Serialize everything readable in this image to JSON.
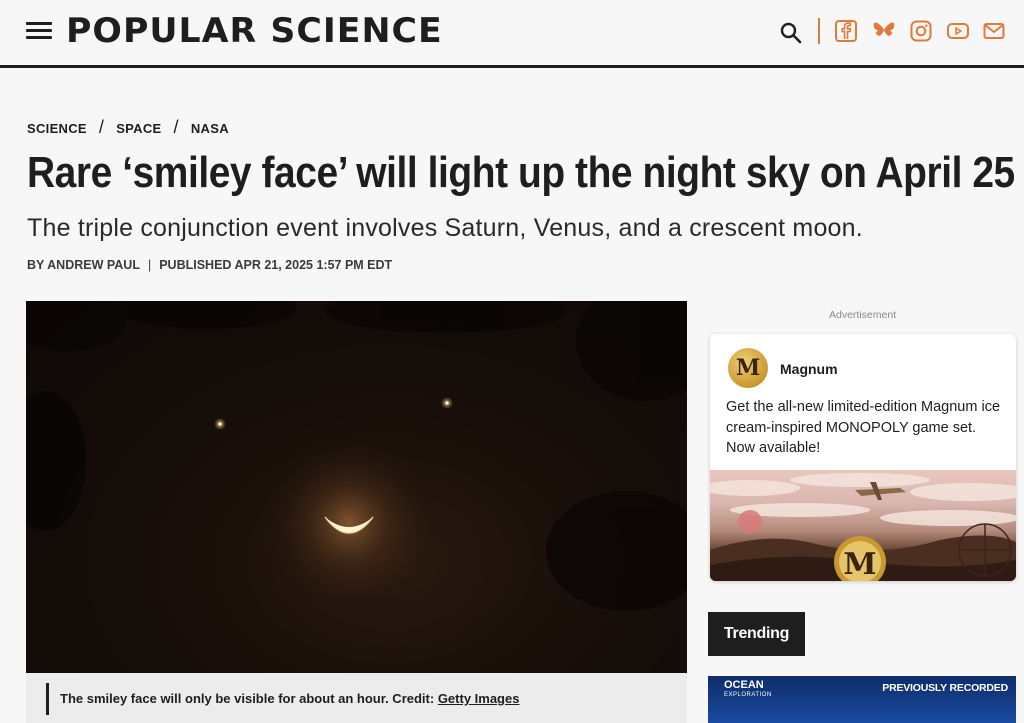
{
  "header": {
    "logo": "POPULAR SCIENCE",
    "accent_color": "#e07a3a",
    "icons": [
      "menu-icon",
      "search-icon",
      "facebook-icon",
      "bluesky-icon",
      "instagram-icon",
      "youtube-icon",
      "email-icon"
    ]
  },
  "breadcrumb": {
    "items": [
      "SCIENCE",
      "SPACE",
      "NASA"
    ],
    "separator": "/"
  },
  "article": {
    "headline": "Rare ‘smiley face’ will light up the night sky on April 25",
    "subhead": "The triple conjunction event involves Saturn, Venus, and a crescent moon.",
    "author": "BY ANDREW PAUL",
    "separator": "|",
    "published": "PUBLISHED APR 21, 2025 1:57 PM EDT",
    "caption": "The smiley face will only be visible for about an hour. Credit: ",
    "caption_credit": "Getty Images"
  },
  "sidebar": {
    "ad_label": "Advertisement",
    "ad": {
      "logo_letter": "M",
      "brand": "Magnum",
      "text": "Get the all-new limited-edition Magnum ice cream-inspired MONOPOLY game set. Now available!",
      "image_letter": "M"
    },
    "trending_label": "Trending",
    "trending_card": {
      "brand": "OCEAN",
      "brand_sub": "EXPLORATION",
      "tag": "PREVIOUSLY RECORDED"
    }
  }
}
